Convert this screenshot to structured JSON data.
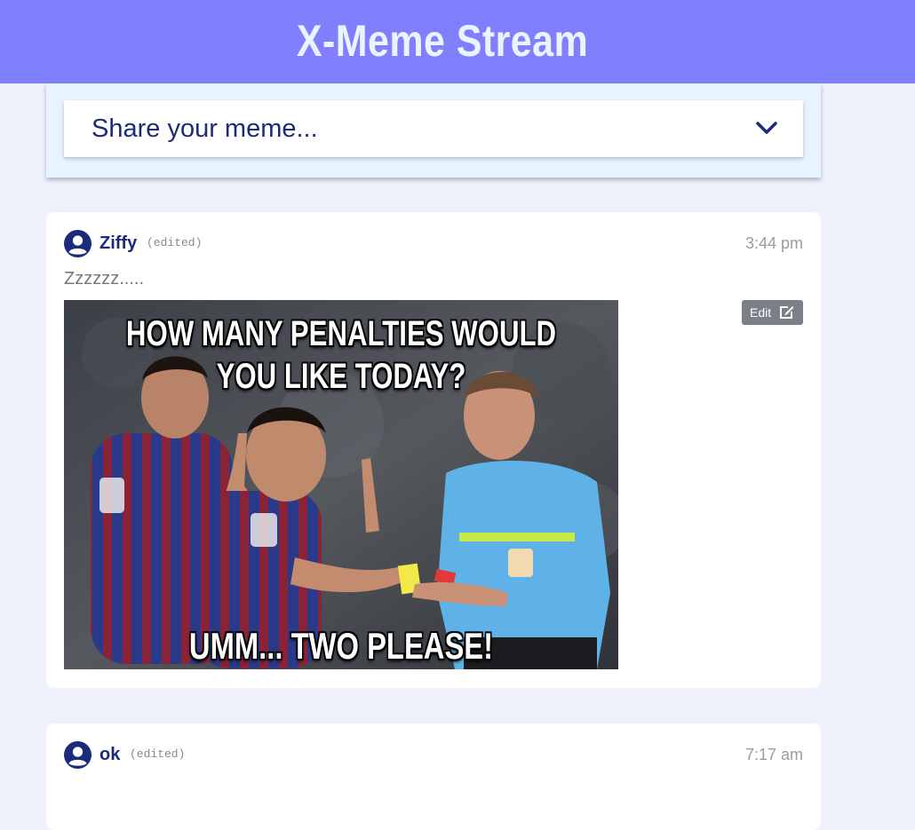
{
  "header": {
    "title": "X-Meme Stream"
  },
  "share": {
    "label": "Share your meme...",
    "icon": "chevron-down-icon"
  },
  "posts": [
    {
      "author": "Ziffy",
      "edited": "(edited)",
      "time": "3:44 pm",
      "caption": "Zzzzzz.....",
      "edit_label": "Edit",
      "meme": {
        "top_text": "HOW MANY PENALTIES WOULD YOU LIKE TODAY?",
        "bottom_text": "UMM... TWO PLEASE!"
      }
    },
    {
      "author": "ok",
      "edited": "(edited)",
      "time": "7:17 am"
    }
  ],
  "colors": {
    "header_bg": "#8080ff",
    "title": "#e9f4ff",
    "accent": "#1d2a7a",
    "page_bg": "#eef0fb"
  }
}
